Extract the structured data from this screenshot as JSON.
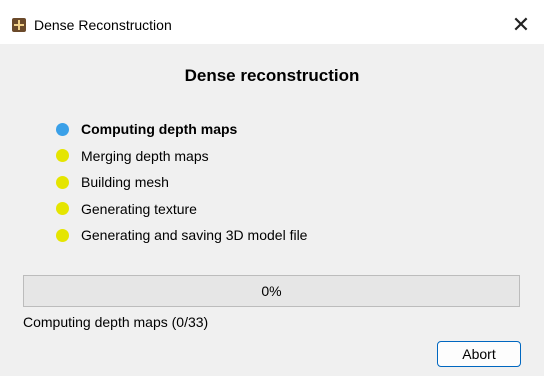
{
  "window": {
    "title": "Dense Reconstruction",
    "close_glyph": "✕"
  },
  "heading": "Dense reconstruction",
  "steps": [
    {
      "label": "Computing depth maps",
      "state": "active",
      "color": "#3aa0e8"
    },
    {
      "label": "Merging depth maps",
      "state": "pending",
      "color": "#e5e500"
    },
    {
      "label": "Building mesh",
      "state": "pending",
      "color": "#e5e500"
    },
    {
      "label": "Generating texture",
      "state": "pending",
      "color": "#e5e500"
    },
    {
      "label": "Generating and saving 3D model file",
      "state": "pending",
      "color": "#e5e500"
    }
  ],
  "progress": {
    "value": 0,
    "text": "0%"
  },
  "status": "Computing depth maps  (0/33)",
  "buttons": {
    "abort": "Abort"
  },
  "colors": {
    "accent": "#0067c0",
    "active_step": "#3aa0e8",
    "pending_step": "#e5e500"
  }
}
